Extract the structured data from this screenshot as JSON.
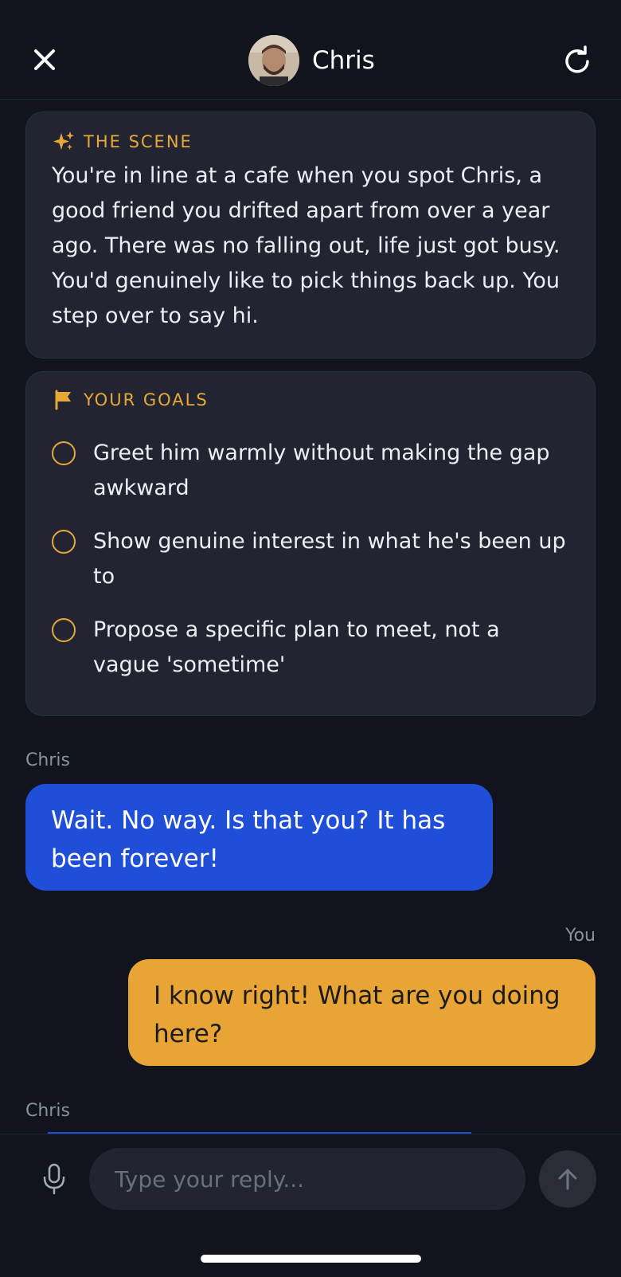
{
  "header": {
    "title": "Chris",
    "close_icon": "close-icon",
    "refresh_icon": "refresh-icon"
  },
  "scene": {
    "label": "THE SCENE",
    "icon": "sparkles-icon",
    "text": "You're in line at a cafe when you spot Chris, a good friend you drifted apart from over a year ago. There was no falling out, life just got busy. You'd genuinely like to pick things back up. You step over to say hi."
  },
  "goals": {
    "label": "YOUR GOALS",
    "icon": "flag-icon",
    "items": [
      {
        "text": "Greet him warmly without making the gap awkward"
      },
      {
        "text": "Show genuine interest in what he's been up to"
      },
      {
        "text": "Propose a specific plan to meet, not a vague 'sometime'"
      }
    ]
  },
  "messages": [
    {
      "sender": "Chris",
      "text": "Wait. No way. Is that you? It has been forever!"
    },
    {
      "sender": "You",
      "text": "I know right! What are you doing here?"
    },
    {
      "sender": "Chris",
      "text": ""
    }
  ],
  "composer": {
    "placeholder": "Type your reply...",
    "mic_icon": "microphone-icon",
    "send_icon": "arrow-up-icon"
  },
  "colors": {
    "background": "#11141d",
    "card": "#222531",
    "accent": "#e8a838",
    "them_bubble": "#1f4fd8",
    "you_bubble": "#e8a434"
  }
}
